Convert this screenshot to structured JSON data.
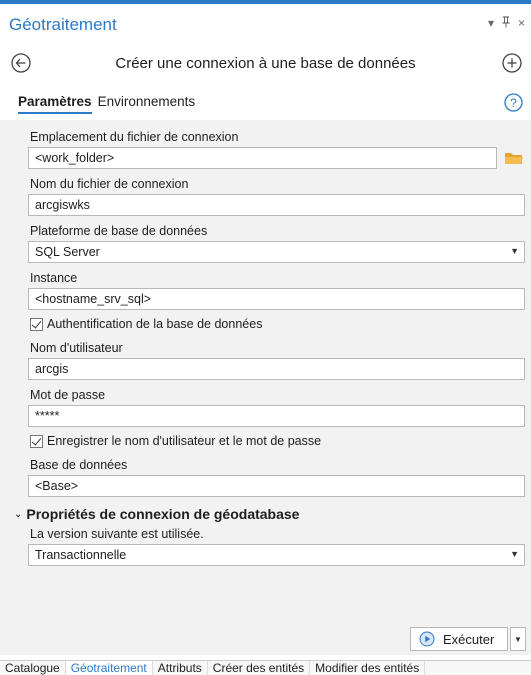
{
  "pane": {
    "title": "Géotraitement",
    "pin_glyph": "▾",
    "dock_glyph": "ᵖ",
    "close_glyph": "×"
  },
  "tool": {
    "title": "Créer une connexion à une base de données"
  },
  "tabs": [
    {
      "label": "Paramètres",
      "active": true
    },
    {
      "label": "Environnements",
      "active": false
    }
  ],
  "form": {
    "location_label": "Emplacement du fichier de connexion",
    "location_value": "<work_folder>",
    "filename_label": "Nom du fichier de connexion",
    "filename_value": "arcgiswks",
    "platform_label": "Plateforme de base de données",
    "platform_value": "SQL Server",
    "instance_label": "Instance",
    "instance_value": "<hostname_srv_sql>",
    "db_auth_label": "Authentification de la base de données",
    "username_label": "Nom d'utilisateur",
    "username_value": "arcgis",
    "password_label": "Mot de passe",
    "password_value": "*****",
    "save_creds_label": "Enregistrer le nom d'utilisateur et le mot de passe",
    "database_label": "Base de données",
    "database_value": "<Base>"
  },
  "geodb_section": {
    "title": "Propriétés de connexion de géodatabase",
    "version_label": "La version suivante est utilisée.",
    "version_value": "Transactionnelle"
  },
  "run": {
    "label": "Exécuter"
  },
  "bottom_tabs": [
    {
      "label": "Catalogue",
      "active": false
    },
    {
      "label": "Géotraitement",
      "active": true
    },
    {
      "label": "Attributs",
      "active": false
    },
    {
      "label": "Créer des entités",
      "active": false
    },
    {
      "label": "Modifier des entités",
      "active": false
    }
  ],
  "colors": {
    "accent": "#2b79c7",
    "folder": "#e6a531"
  }
}
